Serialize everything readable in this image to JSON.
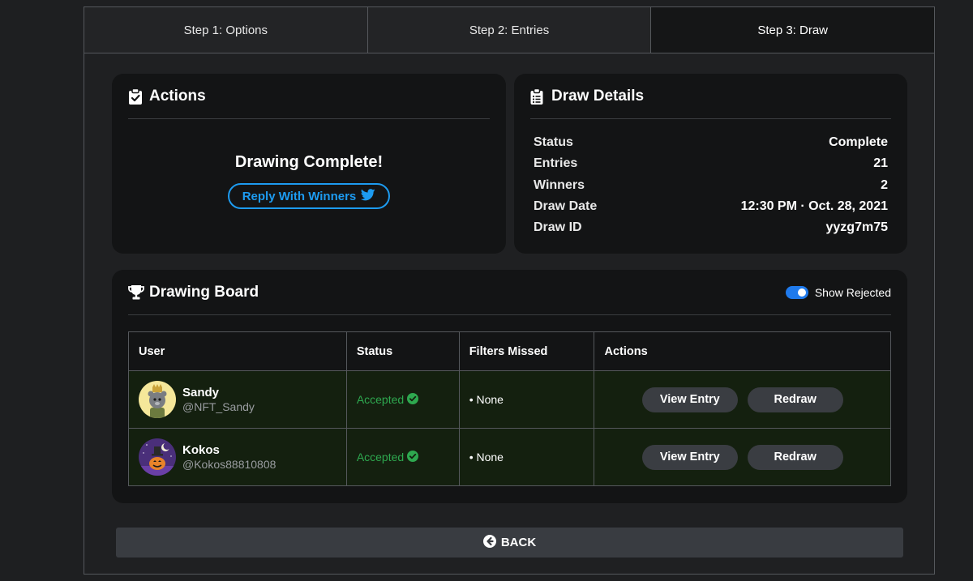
{
  "steps": [
    {
      "label": "Step 1: Options"
    },
    {
      "label": "Step 2: Entries"
    },
    {
      "label": "Step 3: Draw"
    }
  ],
  "actions": {
    "title": "Actions",
    "message": "Drawing Complete!",
    "reply_label": "Reply With Winners"
  },
  "details": {
    "title": "Draw Details",
    "rows": [
      {
        "key": "Status",
        "value": "Complete"
      },
      {
        "key": "Entries",
        "value": "21"
      },
      {
        "key": "Winners",
        "value": "2"
      },
      {
        "key": "Draw Date",
        "value": "12:30 PM · Oct. 28, 2021"
      },
      {
        "key": "Draw ID",
        "value": "yyzg7m75"
      }
    ]
  },
  "board": {
    "title": "Drawing Board",
    "toggle_label": "Show Rejected",
    "toggle_on": true,
    "columns": [
      "User",
      "Status",
      "Filters Missed",
      "Actions"
    ],
    "rows": [
      {
        "name": "Sandy",
        "handle": "@NFT_Sandy",
        "status": "Accepted",
        "filters": "• None",
        "view": "View Entry",
        "redraw": "Redraw"
      },
      {
        "name": "Kokos",
        "handle": "@Kokos88810808",
        "status": "Accepted",
        "filters": "• None",
        "view": "View Entry",
        "redraw": "Redraw"
      }
    ]
  },
  "back_label": "BACK",
  "colors": {
    "accent_blue": "#1d9bf0",
    "accepted_green": "#2ea84f",
    "toggle_blue": "#1f7aec"
  }
}
